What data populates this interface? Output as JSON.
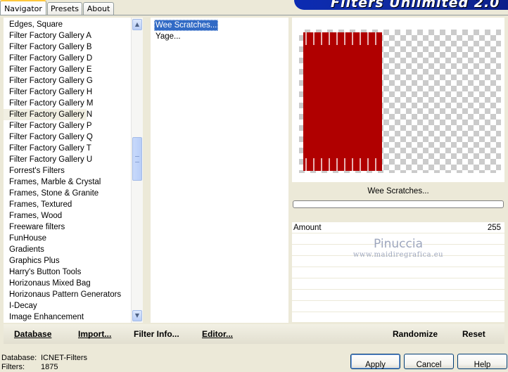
{
  "tabs": [
    {
      "label": "Navigator",
      "active": true
    },
    {
      "label": "Presets",
      "active": false
    },
    {
      "label": "About",
      "active": false
    }
  ],
  "banner_title": "Filters Unlimited 2.0",
  "categories": [
    "Edges, Square",
    "Filter Factory Gallery A",
    "Filter Factory Gallery B",
    "Filter Factory Gallery D",
    "Filter Factory Gallery E",
    "Filter Factory Gallery G",
    "Filter Factory Gallery H",
    "Filter Factory Gallery M",
    "Filter Factory Gallery N",
    "Filter Factory Gallery P",
    "Filter Factory Gallery Q",
    "Filter Factory Gallery T",
    "Filter Factory Gallery U",
    "Forrest's Filters",
    "Frames, Marble & Crystal",
    "Frames, Stone & Granite",
    "Frames, Textured",
    "Frames, Wood",
    "Freeware filters",
    "FunHouse",
    "Gradients",
    "Graphics Plus",
    "Harry's Button Tools",
    "Horizonaus Mixed Bag",
    "Horizonaus Pattern Generators",
    "I-Decay",
    "Image Enhancement"
  ],
  "selected_category": "Filter Factory Gallery N",
  "filters": [
    "Wee Scratches...",
    "Yage..."
  ],
  "selected_filter": "Wee Scratches...",
  "effect_name": "Wee Scratches...",
  "preview_color": "#b00000",
  "parameters": [
    {
      "label": "Amount",
      "value": "255"
    }
  ],
  "watermark": {
    "name": "Pinuccia",
    "url": "www.maidiregrafica.eu"
  },
  "toolbar": {
    "database": "Database",
    "import": "Import...",
    "filter_info": "Filter Info...",
    "editor": "Editor...",
    "randomize": "Randomize",
    "reset": "Reset"
  },
  "status": {
    "database_label": "Database:",
    "database_value": "ICNET-Filters",
    "filters_label": "Filters:",
    "filters_value": "1875"
  },
  "buttons": {
    "apply": "Apply",
    "cancel": "Cancel",
    "help": "Help"
  },
  "icons": {
    "scroll_up": "chevron-up-icon",
    "scroll_down": "chevron-down-icon"
  }
}
